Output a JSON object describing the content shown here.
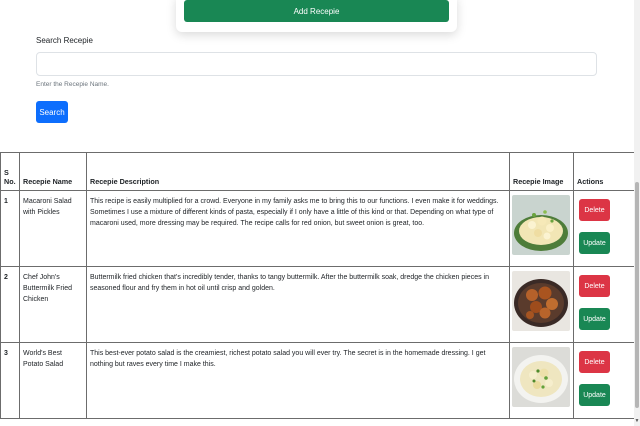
{
  "form": {
    "add_button": "Add Recepie"
  },
  "search": {
    "label": "Search Recepie",
    "value": "",
    "placeholder": "",
    "help_text": "Enter the Recepie Name.",
    "button": "Search"
  },
  "table": {
    "headers": {
      "sno": "S No.",
      "name": "Recepie Name",
      "description": "Recepie Description",
      "image": "Recepie Image",
      "actions": "Actions"
    },
    "rows": [
      {
        "sno": "1",
        "name": "Macaroni Salad with Pickles",
        "description": "This recipe is easily multiplied for a crowd. Everyone in my family asks me to bring this to our functions. I even make it for weddings. Sometimes I use a mixture of different kinds of pasta, especially if I only have a little of this kind or that. Depending on what type of macaroni used, more dressing may be required. The recipe calls for red onion, but sweet onion is great, too.",
        "image_icon": "macaroni-salad-photo",
        "delete_label": "Delete",
        "update_label": "Update"
      },
      {
        "sno": "2",
        "name": "Chef John's Buttermilk Fried Chicken",
        "description": "Buttermilk fried chicken that's incredibly tender, thanks to tangy buttermilk. After the buttermilk soak, dredge the chicken pieces in seasoned flour and fry them in hot oil until crisp and golden.",
        "image_icon": "fried-chicken-photo",
        "delete_label": "Delete",
        "update_label": "Update"
      },
      {
        "sno": "3",
        "name": "World's Best Potato Salad",
        "description": "This best-ever potato salad is the creamiest, richest potato salad you will ever try. The secret is in the homemade dressing. I get nothing but raves every time I make this.",
        "image_icon": "potato-salad-photo",
        "delete_label": "Delete",
        "update_label": "Update"
      }
    ]
  },
  "colors": {
    "primary": "#0d6efd",
    "success": "#198754",
    "danger": "#dc3545"
  }
}
